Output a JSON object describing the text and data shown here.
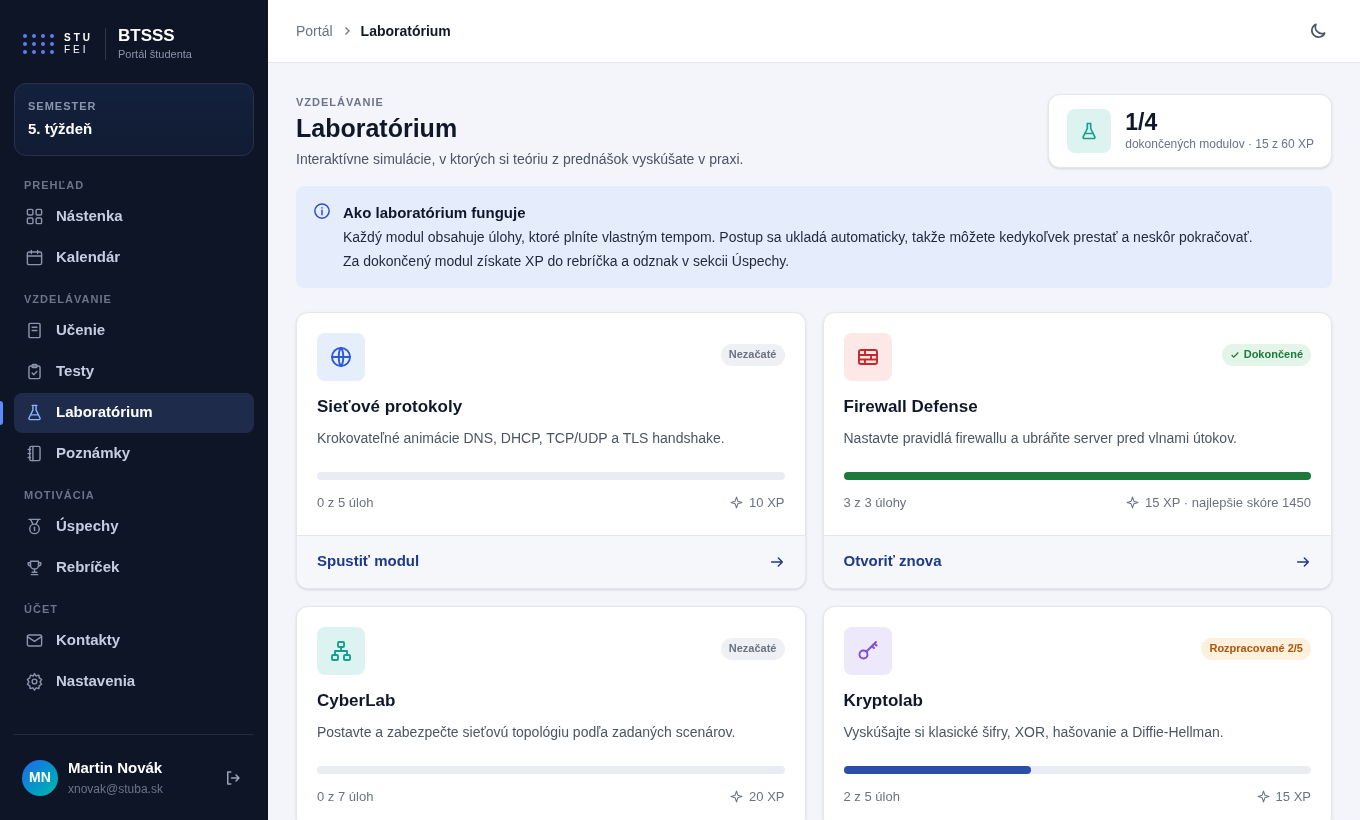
{
  "brand": {
    "logo_top": "STU",
    "logo_bottom": "FEI",
    "title": "BTSSS",
    "subtitle": "Portál študenta"
  },
  "semester": {
    "label": "SEMESTER",
    "value": "5. týždeň"
  },
  "sidebar": {
    "sections": [
      {
        "heading": "PREHĽAD",
        "items": [
          {
            "label": "Nástenka",
            "kind": "grid",
            "selected": false
          },
          {
            "label": "Kalendár",
            "kind": "calendar",
            "selected": false
          }
        ]
      },
      {
        "heading": "VZDELÁVANIE",
        "items": [
          {
            "label": "Učenie",
            "kind": "book",
            "selected": false
          },
          {
            "label": "Testy",
            "kind": "clipboard",
            "selected": false
          },
          {
            "label": "Laboratórium",
            "kind": "flask",
            "selected": true
          },
          {
            "label": "Poznámky",
            "kind": "notebook",
            "selected": false
          }
        ]
      },
      {
        "heading": "MOTIVÁCIA",
        "items": [
          {
            "label": "Úspechy",
            "kind": "medal",
            "selected": false
          },
          {
            "label": "Rebríček",
            "kind": "trophy",
            "selected": false
          }
        ]
      },
      {
        "heading": "ÚČET",
        "items": [
          {
            "label": "Kontakty",
            "kind": "mail",
            "selected": false
          },
          {
            "label": "Nastavenia",
            "kind": "gear",
            "selected": false
          }
        ]
      }
    ]
  },
  "user": {
    "initials": "MN",
    "name": "Martin Novák",
    "email": "xnovak@stuba.sk"
  },
  "breadcrumb": [
    {
      "label": "Portál",
      "current": false
    },
    {
      "label": "Laboratórium",
      "current": true
    }
  ],
  "page": {
    "eyebrow": "VZDELÁVANIE",
    "title": "Laboratórium",
    "subtitle": "Interaktívne simulácie, v ktorých si teóriu z prednášok vyskúšate v praxi."
  },
  "summary": {
    "value": "1/4",
    "caption": "dokončených modulov · 15 z 60 XP"
  },
  "info": {
    "title": "Ako laboratórium funguje",
    "lines": [
      "Každý modul obsahuje úlohy, ktoré plníte vlastným tempom. Postup sa ukladá automaticky, takže môžete kedykoľvek prestať a neskôr pokračovať.",
      "Za dokončený modul získate XP do rebríčka a odznak v sekcii Úspechy."
    ]
  },
  "modules": [
    {
      "kind": "not_started",
      "badge": "Nezačaté",
      "title": "Sieťové protokoly",
      "description": "Krokovateľné animácie DNS, DHCP, TCP/UDP a TLS handshake.",
      "level": 0,
      "progress": "0 z 5 úloh",
      "xp": "10 XP",
      "action": "Spustiť modul"
    },
    {
      "kind": "done",
      "badge": "Dokončené",
      "title": "Firewall Defense",
      "description": "Nastavte pravidlá firewallu a ubráňte server pred vlnami útokov.",
      "level": 1,
      "progress": "3 z 3 úlohy",
      "xp": "15 XP · najlepšie skóre 1450",
      "action": "Otvoriť znova"
    },
    {
      "kind": "not_started",
      "badge": "Nezačaté",
      "title": "CyberLab",
      "description": "Postavte a zabezpečte sieťovú topológiu podľa zadaných scenárov.",
      "level": 0,
      "progress": "0 z 7 úloh",
      "xp": "20 XP"
    },
    {
      "kind": "in_progress",
      "badge": "Rozpracované 2/5",
      "title": "Kryptolab",
      "description": "Vyskúšajte si klasické šifry, XOR, hašovanie a Diffie-Hellman.",
      "level": 0.4,
      "progress": "2 z 5 úloh",
      "xp": "15 XP"
    }
  ]
}
